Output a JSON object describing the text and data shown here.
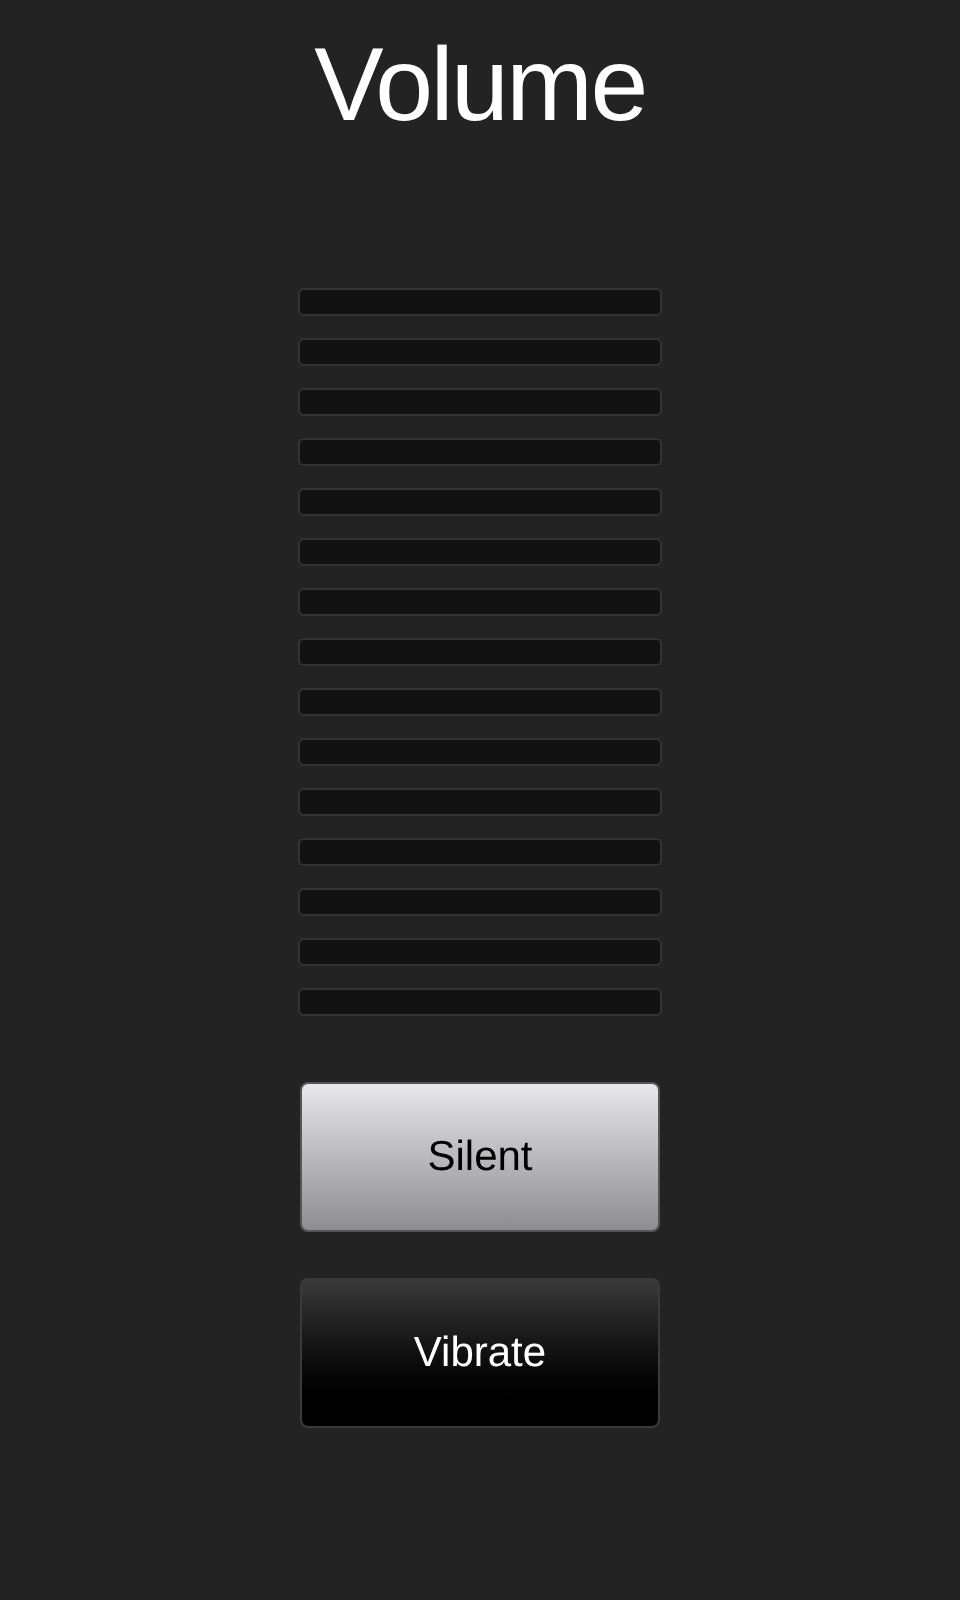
{
  "title": "Volume",
  "volume_segments": [
    {
      "lit": false
    },
    {
      "lit": false
    },
    {
      "lit": false
    },
    {
      "lit": false
    },
    {
      "lit": false
    },
    {
      "lit": false
    },
    {
      "lit": false
    },
    {
      "lit": false
    },
    {
      "lit": false
    },
    {
      "lit": false
    },
    {
      "lit": false
    },
    {
      "lit": false
    },
    {
      "lit": false
    },
    {
      "lit": false
    },
    {
      "lit": false
    }
  ],
  "buttons": [
    {
      "label": "Silent",
      "selected": true
    },
    {
      "label": "Vibrate",
      "selected": false
    }
  ]
}
